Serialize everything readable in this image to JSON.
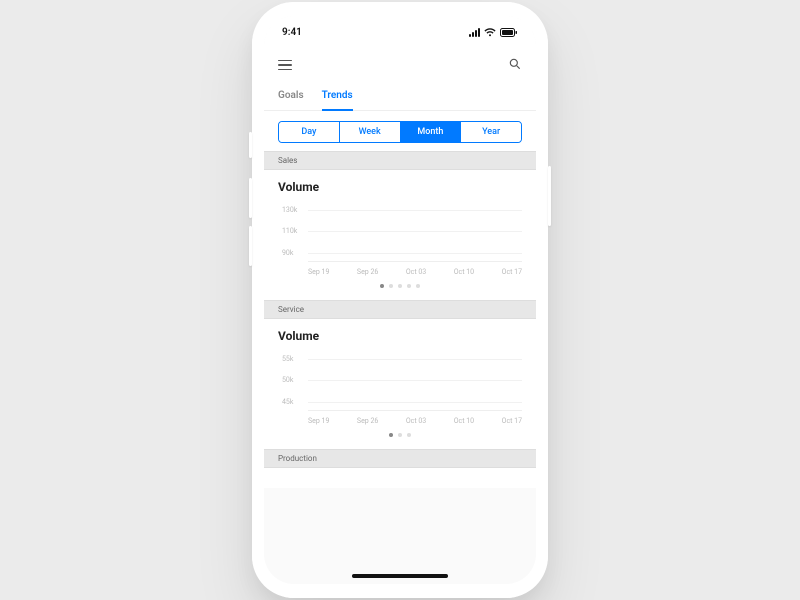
{
  "status": {
    "time": "9:41"
  },
  "tabs": [
    {
      "label": "Goals",
      "active": false
    },
    {
      "label": "Trends",
      "active": true
    }
  ],
  "segmented": [
    {
      "label": "Day",
      "active": false
    },
    {
      "label": "Week",
      "active": false
    },
    {
      "label": "Month",
      "active": true
    },
    {
      "label": "Year",
      "active": false
    }
  ],
  "sections": [
    {
      "header": "Sales",
      "title": "Volume",
      "dot_count": 5,
      "active_dot": 0
    },
    {
      "header": "Service",
      "title": "Volume",
      "dot_count": 3,
      "active_dot": 0
    },
    {
      "header": "Production",
      "title": "",
      "dot_count": 0,
      "active_dot": 0
    }
  ],
  "chart_data": [
    {
      "type": "line",
      "title": "Volume",
      "section": "Sales",
      "categories": [
        "Sep 19",
        "Sep 26",
        "Oct 03",
        "Oct 10",
        "Oct 17"
      ],
      "values": [],
      "ytick_labels": [
        "130k",
        "110k",
        "90k"
      ],
      "ylim": [
        90000,
        130000
      ],
      "xlabel": "",
      "ylabel": ""
    },
    {
      "type": "line",
      "title": "Volume",
      "section": "Service",
      "categories": [
        "Sep 19",
        "Sep 26",
        "Oct 03",
        "Oct 10",
        "Oct 17"
      ],
      "values": [],
      "ytick_labels": [
        "55k",
        "50k",
        "45k"
      ],
      "ylim": [
        45000,
        55000
      ],
      "xlabel": "",
      "ylabel": ""
    }
  ]
}
